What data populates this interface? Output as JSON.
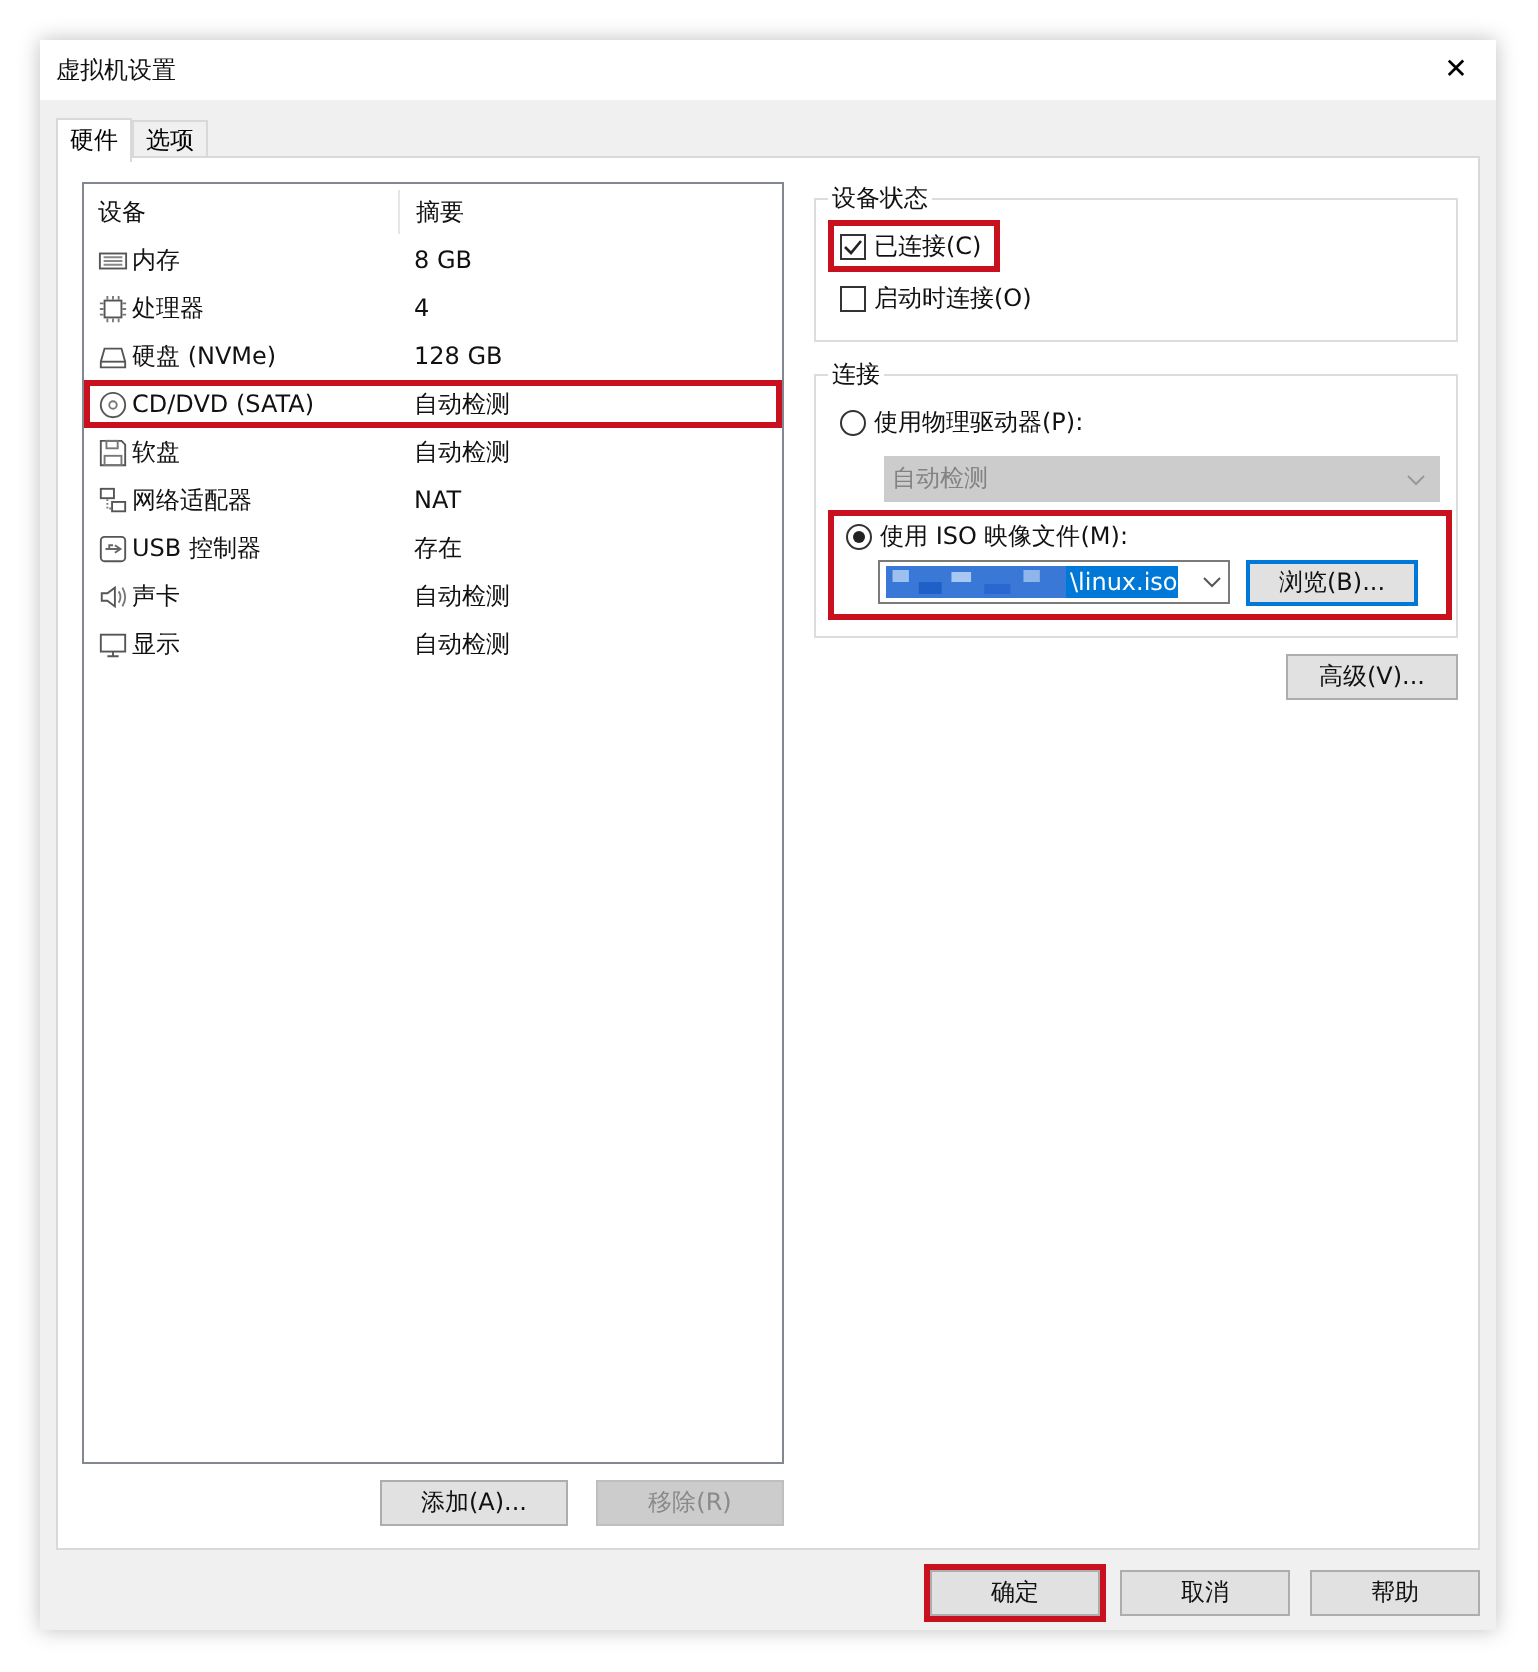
{
  "window": {
    "title": "虚拟机设置",
    "close": "✕"
  },
  "tabs": [
    {
      "label": "硬件",
      "selected": true
    },
    {
      "label": "选项",
      "selected": false
    }
  ],
  "device_list": {
    "columns": [
      "设备",
      "摘要"
    ],
    "rows": [
      {
        "kind": "memory",
        "name": "内存",
        "summary": "8 GB",
        "highlighted": false
      },
      {
        "kind": "cpu",
        "name": "处理器",
        "summary": "4",
        "highlighted": false
      },
      {
        "kind": "disk",
        "name": "硬盘 (NVMe)",
        "summary": "128 GB",
        "highlighted": false
      },
      {
        "kind": "cdrom",
        "name": "CD/DVD (SATA)",
        "summary": "自动检测",
        "highlighted": true
      },
      {
        "kind": "floppy",
        "name": "软盘",
        "summary": "自动检测",
        "highlighted": false
      },
      {
        "kind": "network",
        "name": "网络适配器",
        "summary": "NAT",
        "highlighted": false
      },
      {
        "kind": "usb",
        "name": "USB 控制器",
        "summary": "存在",
        "highlighted": false
      },
      {
        "kind": "sound",
        "name": "声卡",
        "summary": "自动检测",
        "highlighted": false
      },
      {
        "kind": "display",
        "name": "显示",
        "summary": "自动检测",
        "highlighted": false
      }
    ],
    "buttons": [
      {
        "label": "添加(A)...",
        "disabled": false
      },
      {
        "label": "移除(R)",
        "disabled": true
      }
    ]
  },
  "device_status": {
    "title": "设备状态",
    "options": [
      {
        "label": "已连接(C)",
        "checked": true,
        "highlighted": true
      },
      {
        "label": "启动时连接(O)",
        "checked": false,
        "highlighted": false
      }
    ]
  },
  "connection": {
    "title": "连接",
    "physical": {
      "label": "使用物理驱动器(P):",
      "selected": false,
      "drive": "自动检测",
      "disabled": true
    },
    "iso": {
      "label": "使用 ISO 映像文件(M):",
      "selected": true,
      "highlighted": true,
      "path": "\\linux.iso",
      "browse": "浏览(B)..."
    }
  },
  "advanced_button": "高级(V)...",
  "footer_buttons": [
    {
      "label": "确定",
      "highlighted": true
    },
    {
      "label": "取消",
      "highlighted": false
    },
    {
      "label": "帮助",
      "highlighted": false
    }
  ]
}
